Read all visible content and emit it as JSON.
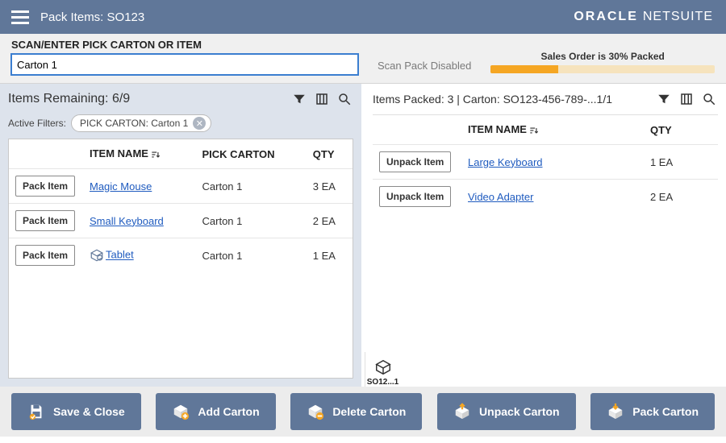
{
  "appbar": {
    "title": "Pack Items: SO123"
  },
  "brand": {
    "oracle": "ORACLE",
    "product": "NETSUITE"
  },
  "scan": {
    "label": "SCAN/ENTER PICK CARTON OR ITEM",
    "value": "Carton 1",
    "disabled_text": "Scan Pack Disabled"
  },
  "progress": {
    "label": "Sales Order is 30% Packed",
    "percent": 30
  },
  "left": {
    "header": "Items Remaining: 6/9",
    "active_filters_label": "Active Filters:",
    "filter_chip": "PICK CARTON: Carton 1",
    "columns": {
      "action": "",
      "item": "ITEM NAME",
      "carton": "PICK CARTON",
      "qty": "QTY"
    },
    "pack_label": "Pack Item",
    "rows": [
      {
        "item": "Magic Mouse",
        "carton": "Carton 1",
        "qty": "3 EA",
        "flag": false
      },
      {
        "item": "Small Keyboard",
        "carton": "Carton 1",
        "qty": "2 EA",
        "flag": false
      },
      {
        "item": "Tablet",
        "carton": "Carton 1",
        "qty": "1 EA",
        "flag": true
      }
    ]
  },
  "right": {
    "header": "Items Packed: 3 | Carton: SO123-456-789-...1/1",
    "columns": {
      "action": "",
      "item": "ITEM NAME",
      "qty": "QTY"
    },
    "unpack_label": "Unpack Item",
    "rows": [
      {
        "item": "Large Keyboard",
        "qty": "1 EA"
      },
      {
        "item": "Video Adapter",
        "qty": "2 EA"
      }
    ],
    "tab_label": "SO12...1"
  },
  "footer": {
    "save": "Save & Close",
    "add": "Add Carton",
    "delete": "Delete Carton",
    "unpack": "Unpack Carton",
    "pack": "Pack Carton"
  }
}
